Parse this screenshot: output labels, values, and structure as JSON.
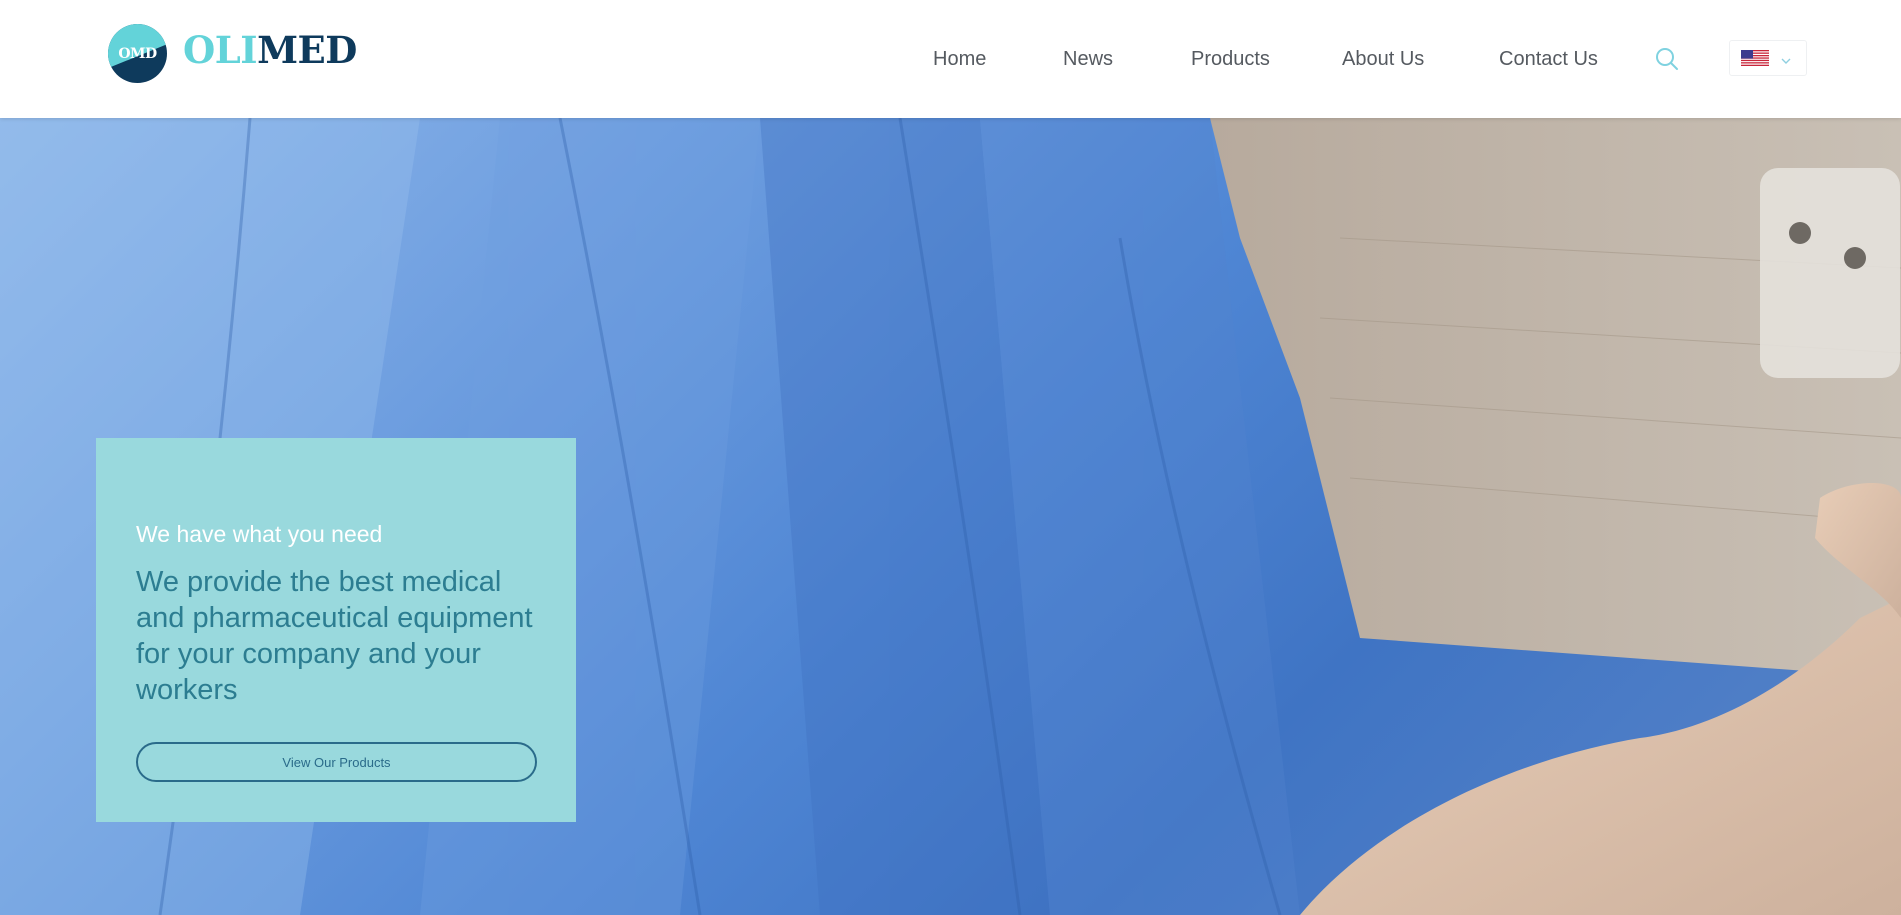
{
  "brand": {
    "badge_text": "OMD",
    "name_part1": "OLI",
    "name_part2": "MED",
    "color_primary": "#63d3d9",
    "color_dark": "#0e3a5c"
  },
  "nav": {
    "items": [
      {
        "label": "Home"
      },
      {
        "label": "News"
      },
      {
        "label": "Products"
      },
      {
        "label": "About Us"
      },
      {
        "label": "Contact Us"
      }
    ],
    "search_icon": "search-icon",
    "language": {
      "flag": "us-flag-icon",
      "chevron": "chevron-down-icon"
    }
  },
  "hero": {
    "image_description_icon": "hero-photo",
    "card": {
      "eyebrow": "We have what you need",
      "headline": "We provide the best medical and pharmaceutical equipment for your company and your workers",
      "button_label": "View Our Products",
      "background_color": "#99d9dd"
    }
  }
}
